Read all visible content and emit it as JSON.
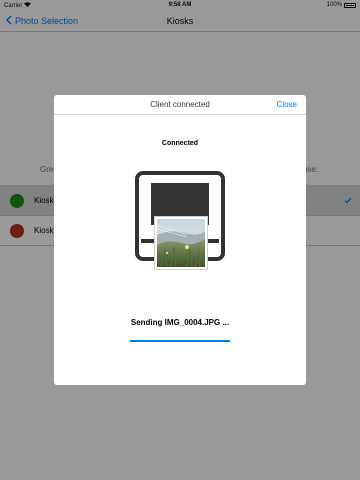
{
  "status_bar": {
    "carrier": "Carrier",
    "time": "9:58 AM",
    "battery": "100%"
  },
  "nav": {
    "back_label": "Photo Selection",
    "title": "Kiosks"
  },
  "list": {
    "header_left": "Gre",
    "header_right": "use:",
    "rows": [
      {
        "label": "Kiosk",
        "color": "#1f8a1f",
        "selected": true
      },
      {
        "label": "Kiosk",
        "color": "#b8321a",
        "selected": false
      }
    ]
  },
  "modal": {
    "title": "Client connected",
    "close_label": "Close",
    "status": "Connected",
    "sending_text": "Sending IMG_0004.JPG ...",
    "progress": 1.0
  },
  "colors": {
    "accent": "#007aff",
    "printer": "#333333"
  }
}
